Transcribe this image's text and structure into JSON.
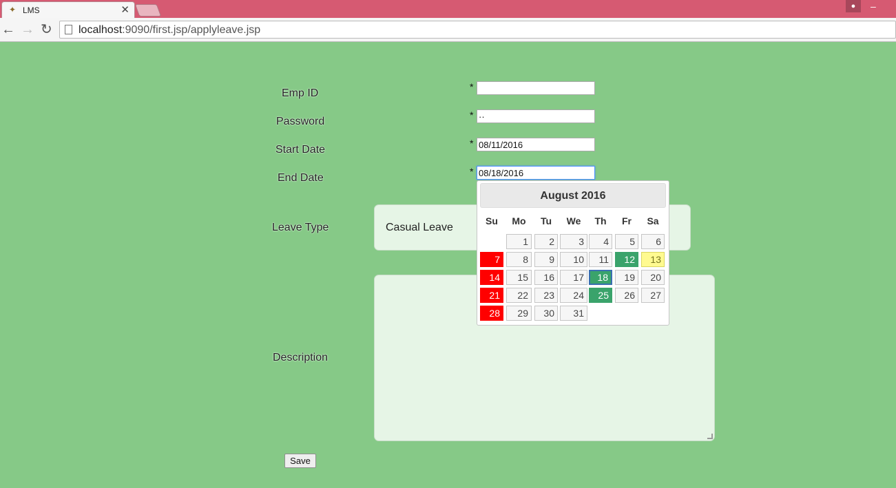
{
  "browser": {
    "tab_title": "LMS",
    "tab_close": "✕",
    "url_host": "localhost",
    "url_rest": ":9090/first.jsp/applyleave.jsp"
  },
  "form": {
    "emp_id_label": "Emp ID",
    "password_label": "Password",
    "start_date_label": "Start Date",
    "end_date_label": "End Date",
    "leave_type_label": "Leave Type",
    "description_label": "Description",
    "required_marker": "*",
    "emp_id_value": "",
    "password_value": "··",
    "start_date_value": "08/11/2016",
    "end_date_value": "08/18/2016",
    "leave_type_value": "Casual Leave",
    "description_value": "",
    "save_label": "Save"
  },
  "datepicker": {
    "title": "August 2016",
    "weekdays": [
      "Su",
      "Mo",
      "Tu",
      "We",
      "Th",
      "Fr",
      "Sa"
    ],
    "first_weekday_index": 1,
    "days_in_month": 31,
    "today": 13,
    "selected": 18,
    "green_days": [
      12,
      25
    ],
    "colors": {
      "sunday": "#ff0000",
      "green": "#3aa36b",
      "today": "#fffa90",
      "selected_border": "#3a6fb0"
    }
  },
  "colors": {
    "page_background": "#86c987",
    "titlebar": "#d65a72"
  }
}
